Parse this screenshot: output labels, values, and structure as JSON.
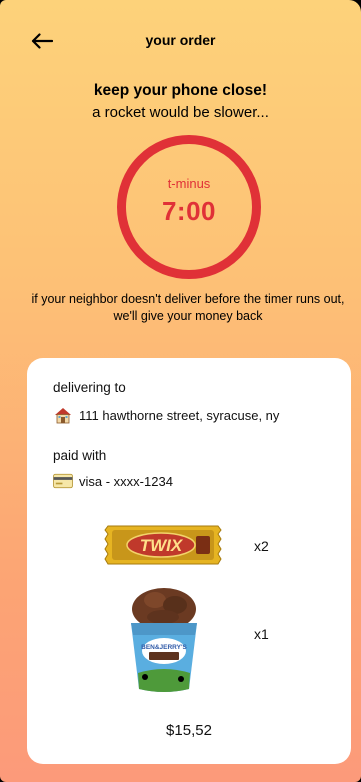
{
  "header": {
    "title": "your order"
  },
  "headline": "keep your phone close!",
  "subhead": "a rocket would be slower...",
  "timer": {
    "label": "t-minus",
    "value": "7:00",
    "color": "#e03137"
  },
  "notice": "if your neighbor doesn't deliver before the timer runs out, we'll give your money back",
  "order": {
    "delivering_label": "delivering to",
    "address": "111 hawthorne street, syracuse, ny",
    "address_icon": "house-icon",
    "paid_label": "paid with",
    "payment": "visa - xxxx-1234",
    "payment_icon": "credit-card-icon",
    "items": [
      {
        "name": "TWIX",
        "quantity": "x2"
      },
      {
        "name": "BEN&JERRY'S",
        "quantity": "x1"
      }
    ],
    "total": "$15,52"
  },
  "colors": {
    "background_top": "#fdd27a",
    "background_bottom": "#fc9a7a",
    "accent": "#e03137",
    "card": "#ffffff"
  }
}
